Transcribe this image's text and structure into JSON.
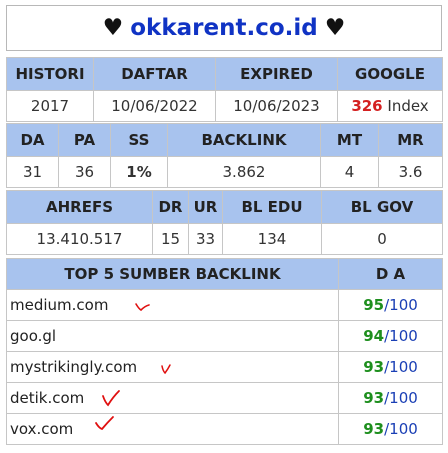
{
  "banner": {
    "heart_left": "♥",
    "domain": "okkarent.co.id",
    "heart_right": "♥"
  },
  "registration": {
    "headers": [
      "HISTORI",
      "DAFTAR",
      "EXPIRED",
      "GOOGLE"
    ],
    "histori": "2017",
    "daftar": "10/06/2022",
    "expired": "10/06/2023",
    "google_count": "326",
    "google_label": " Index"
  },
  "metrics": {
    "headers": [
      "DA",
      "PA",
      "SS",
      "BACKLINK",
      "MT",
      "MR"
    ],
    "da": "31",
    "pa": "36",
    "ss": "1%",
    "backlink": "3.862",
    "mt": "4",
    "mr": "3.6"
  },
  "ahrefs": {
    "headers": [
      "AHREFS",
      "DR",
      "UR",
      "BL EDU",
      "BL GOV"
    ],
    "ahrefs": "13.410.517",
    "dr": "15",
    "ur": "33",
    "bl_edu": "134",
    "bl_gov": "0"
  },
  "top_backlinks": {
    "header_title": "TOP 5 SUMBER BACKLINK",
    "header_da": "D A",
    "rows": [
      {
        "site": "medium.com",
        "da": "95",
        "max": "/100"
      },
      {
        "site": "goo.gl",
        "da": "94",
        "max": "/100"
      },
      {
        "site": "mystrikingly.com",
        "da": "93",
        "max": "/100"
      },
      {
        "site": "detik.com",
        "da": "93",
        "max": "/100"
      },
      {
        "site": "vox.com",
        "da": "93",
        "max": "/100"
      }
    ]
  },
  "colors": {
    "header_blue": "#a8c3ee",
    "header_green": "#0b8a1e",
    "domain_blue": "#1033c4",
    "value_green": "#1e8f1e",
    "value_red": "#d42020",
    "check_red": "#e01010"
  },
  "icons": [
    "heart-icon",
    "check-mark-icon"
  ]
}
